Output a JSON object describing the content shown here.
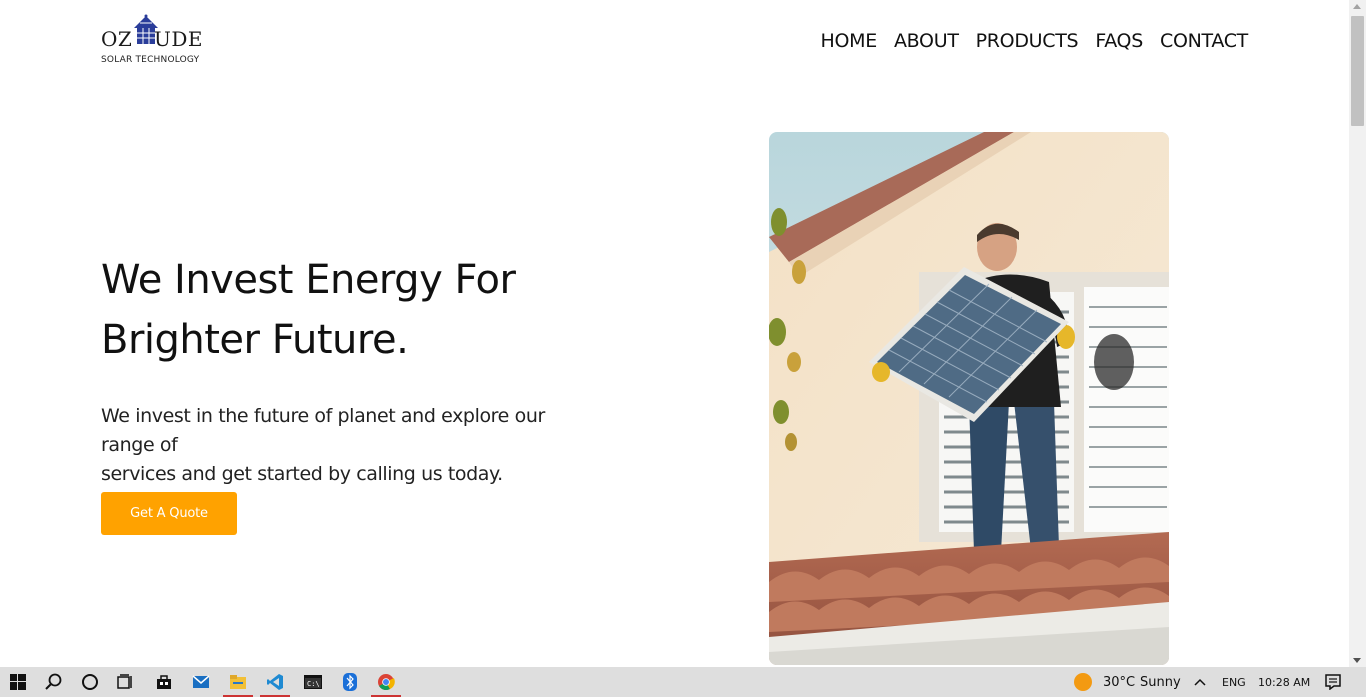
{
  "logo": {
    "left_text": "OZ",
    "right_text": "UDE",
    "subtitle": "SOLAR TECHNOLOGY"
  },
  "nav": {
    "items": [
      "HOME",
      "ABOUT",
      "PRODUCTS",
      "FAQS",
      "CONTACT"
    ]
  },
  "hero": {
    "title_line1": "We Invest Energy For",
    "title_line2": "Brighter Future.",
    "text_line1": "We invest in the future of planet and explore our range of",
    "text_line2": "services and get started by calling us today.",
    "cta_label": "Get A Quote"
  },
  "colors": {
    "accent": "#ffa200",
    "taskbar": "#dedede"
  },
  "taskbar": {
    "apps": [
      "windows-start-icon",
      "search-icon",
      "cortana-icon",
      "task-view-icon",
      "store-icon",
      "mail-icon",
      "file-explorer-icon",
      "vscode-icon",
      "terminal-icon",
      "bluetooth-icon",
      "chrome-icon"
    ],
    "weather_temp": "30°C",
    "weather_desc": "Sunny",
    "language": "ENG",
    "time": "10:28 AM"
  }
}
